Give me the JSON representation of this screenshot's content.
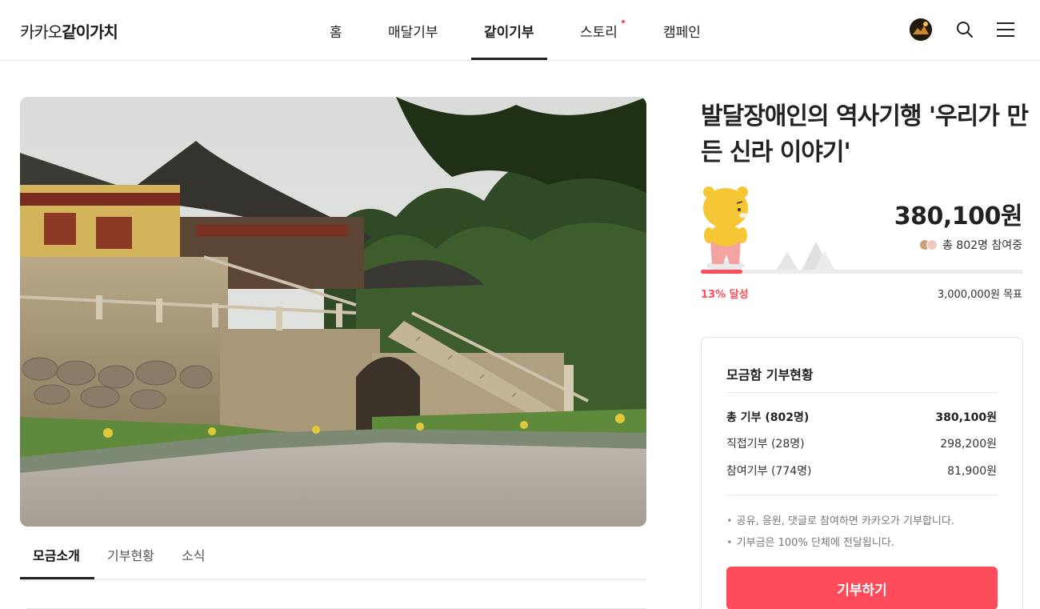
{
  "header": {
    "logo_regular": "카카오",
    "logo_bold": "같이가치",
    "nav": [
      {
        "label": "홈"
      },
      {
        "label": "매달기부"
      },
      {
        "label": "같이기부",
        "active": true
      },
      {
        "label": "스토리",
        "new_dot": true
      },
      {
        "label": "캠페인"
      }
    ],
    "icons": [
      "profile-avatar",
      "search-icon",
      "menu-icon"
    ]
  },
  "fundraiser": {
    "title": "발달장애인의 역사기행 '우리가 만든 신라 이야기'",
    "amount": "380,100원",
    "participants_text": "총 802명 참여중",
    "progress_percent": 13,
    "progress_label": "13% 달성",
    "goal_label": "3,000,000원 목표"
  },
  "tabs": [
    {
      "label": "모금소개",
      "active": true
    },
    {
      "label": "기부현황"
    },
    {
      "label": "소식"
    }
  ],
  "donation_card": {
    "title": "모금함 기부현황",
    "rows": [
      {
        "label": "총 기부 (802명)",
        "value": "380,100원"
      },
      {
        "label": "직접기부 (28명)",
        "value": "298,200원"
      },
      {
        "label": "참여기부 (774명)",
        "value": "81,900원"
      }
    ],
    "notes": [
      "공유, 응원, 댓글로 참여하면 카카오가 기부합니다.",
      "기부금은 100% 단체에 전달됩니다."
    ],
    "button_label": "기부하기"
  },
  "colors": {
    "accent": "#ff4c5a",
    "text": "#222222",
    "divider": "#e5e5e5"
  }
}
